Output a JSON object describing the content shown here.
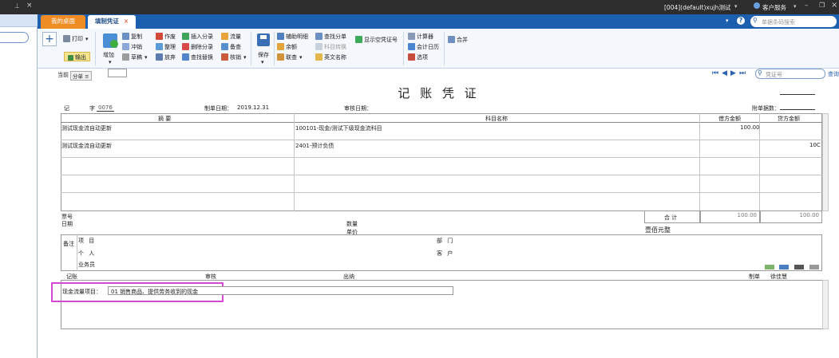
{
  "topbar": {
    "account": "[004](default)xujh测试",
    "service": "客户服务",
    "search_placeholder": "单据条码搜索",
    "help": "?"
  },
  "tabs": {
    "desk": "我的桌面",
    "voucher": "填制凭证",
    "close": "×"
  },
  "ribbon": {
    "add_big": "+",
    "print": "打印",
    "output": "输出",
    "increase": "增加",
    "copy": "复制",
    "offset": "冲销",
    "draft": "草稿",
    "void": "作废",
    "tidy": "整理",
    "discard": "放弃",
    "insert_entry": "插入分录",
    "delete_entry": "删除分录",
    "find_replace": "查找替换",
    "flow": "流量",
    "backup": "备查",
    "verify": "核销",
    "save": "保存",
    "aux": "辅助明细",
    "balance": "余额",
    "link": "联查",
    "find_entry": "查找分单",
    "subject_convert": "科目转换",
    "english_name": "英文名称",
    "show_empty": "显示空凭证号",
    "calculator": "计算器",
    "acct_calendar": "会计日历",
    "options": "选项",
    "merge": "合并"
  },
  "voucher": {
    "current_label": "当前",
    "current_tip": "分单 ≡",
    "title": "记 账 凭 证",
    "type": "记",
    "num_label": "字",
    "number": "0076",
    "date_label": "制单日期：",
    "date": "2019.12.31",
    "audit_label": "审核日期：",
    "attach_label": "附单据数：",
    "nav_search_placeholder": "凭证号",
    "nav_query": "查询",
    "col_summary": "摘 要",
    "col_subject": "科目名称",
    "col_debit": "借方金额",
    "col_credit": "贷方金额",
    "rows": [
      {
        "summary": "测试现金流自动更新",
        "subject": "100101-现金/测试下级现金流科目",
        "debit": "100.00",
        "credit": ""
      },
      {
        "summary": "测试现金流自动更新",
        "subject": "2401-预计负债",
        "debit": "",
        "credit": "10C"
      },
      {
        "summary": "",
        "subject": "",
        "debit": "",
        "credit": ""
      },
      {
        "summary": "",
        "subject": "",
        "debit": "",
        "credit": ""
      },
      {
        "summary": "",
        "subject": "",
        "debit": "",
        "credit": ""
      }
    ],
    "ticket_no": "票号",
    "ticket_date": "日期",
    "quantity": "数量",
    "unit_price": "单价",
    "total_label": "合 计",
    "total_debit": "100.00",
    "total_credit": "100.00",
    "amount_words": "壹佰元整",
    "remark": "备注",
    "project": "项 目",
    "dept": "部 门",
    "person": "个 人",
    "customer": "客 户",
    "salesman": "业务员",
    "bookkeep": "记账",
    "auditor": "审核",
    "cashier": "出纳",
    "maker_label": "制单",
    "maker": "徐佳慧",
    "cashflow_label": "现金流量项目：",
    "cashflow_value": "01 销售商品、提供劳务收到的现金"
  },
  "colors": {
    "accent": "#1c5fae",
    "tab_orange": "#f08c24",
    "highlight": "#d24ad2"
  }
}
